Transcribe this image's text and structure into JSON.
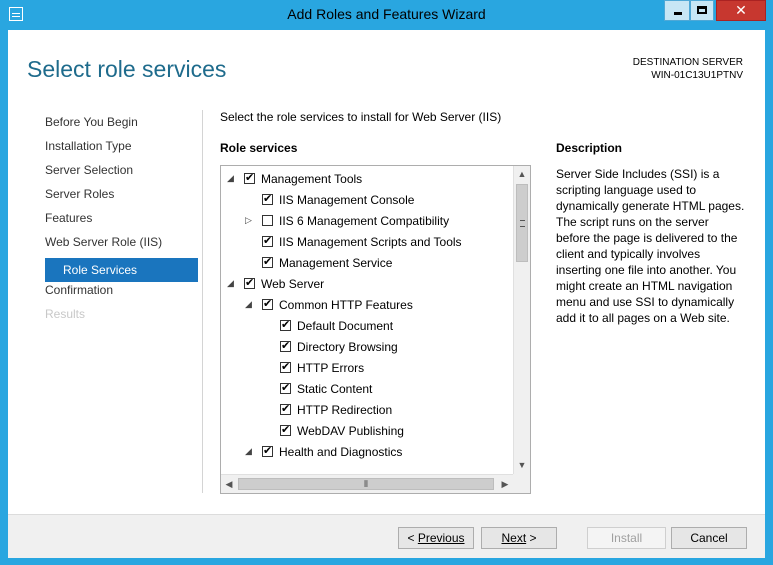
{
  "window": {
    "title": "Add Roles and Features Wizard"
  },
  "header": {
    "page_title": "Select role services",
    "destination_label": "DESTINATION SERVER",
    "destination_server": "WIN-01C13U1PTNV"
  },
  "nav": {
    "items": [
      {
        "label": "Before You Begin"
      },
      {
        "label": "Installation Type"
      },
      {
        "label": "Server Selection"
      },
      {
        "label": "Server Roles"
      },
      {
        "label": "Features"
      },
      {
        "label": "Web Server Role (IIS)"
      },
      {
        "label": "Role Services"
      },
      {
        "label": "Confirmation"
      },
      {
        "label": "Results"
      }
    ]
  },
  "main": {
    "instruction": "Select the role services to install for Web Server (IIS)",
    "role_services_header": "Role services",
    "tree": [
      {
        "label": "Management Tools",
        "checked": true,
        "expander": "expanded"
      },
      {
        "label": "IIS Management Console",
        "checked": true,
        "expander": ""
      },
      {
        "label": "IIS 6 Management Compatibility",
        "checked": false,
        "expander": "collapsed"
      },
      {
        "label": "IIS Management Scripts and Tools",
        "checked": true,
        "expander": ""
      },
      {
        "label": "Management Service",
        "checked": true,
        "expander": ""
      },
      {
        "label": "Web Server",
        "checked": true,
        "expander": "expanded"
      },
      {
        "label": "Common HTTP Features",
        "checked": true,
        "expander": "expanded"
      },
      {
        "label": "Default Document",
        "checked": true,
        "expander": ""
      },
      {
        "label": "Directory Browsing",
        "checked": true,
        "expander": ""
      },
      {
        "label": "HTTP Errors",
        "checked": true,
        "expander": ""
      },
      {
        "label": "Static Content",
        "checked": true,
        "expander": ""
      },
      {
        "label": "HTTP Redirection",
        "checked": true,
        "expander": ""
      },
      {
        "label": "WebDAV Publishing",
        "checked": true,
        "expander": ""
      },
      {
        "label": "Health and Diagnostics",
        "checked": true,
        "expander": "expanded"
      }
    ]
  },
  "description": {
    "header": "Description",
    "text": "Server Side Includes (SSI) is a scripting language used to dynamically generate HTML pages. The script runs on the server before the page is delivered to the client and typically involves inserting one file into another. You might create an HTML navigation menu and use SSI to dynamically add it to all pages on a Web site."
  },
  "footer": {
    "previous_label": "Previous",
    "next_label": "Next",
    "install_label": "Install",
    "cancel_label": "Cancel"
  },
  "icons": {
    "expanded": "◢",
    "collapsed": "▷",
    "checked": "✔",
    "scroll_up": "▲",
    "scroll_down": "▼",
    "scroll_left": "◀",
    "scroll_right": "▶"
  }
}
